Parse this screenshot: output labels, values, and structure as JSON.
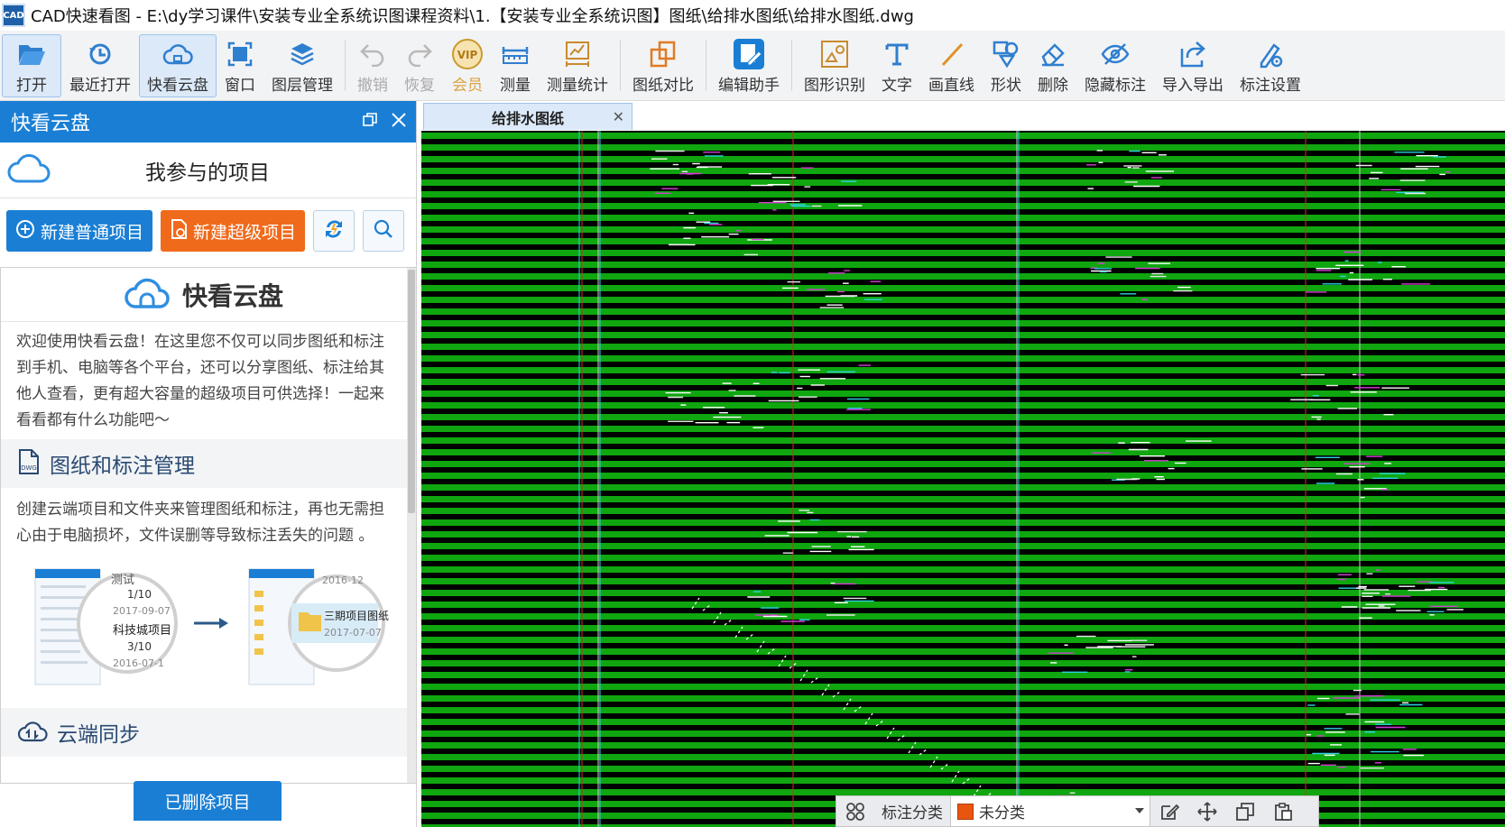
{
  "window": {
    "app_icon_text": "CAD",
    "title": "CAD快速看图 - E:\\dy学习课件\\安装专业全系统识图课程资料\\1.【安装专业全系统识图】图纸\\给排水图纸\\给排水图纸.dwg"
  },
  "toolbar": {
    "open": "打开",
    "recent": "最近打开",
    "cloud": "快看云盘",
    "window": "窗口",
    "layers": "图层管理",
    "undo": "撤销",
    "redo": "恢复",
    "vip": "会员",
    "vip_badge": "VIP",
    "measure": "测量",
    "measure_stats": "测量统计",
    "compare": "图纸对比",
    "edit_assistant": "编辑助手",
    "shape_recognize": "图形识别",
    "text": "文字",
    "line": "画直线",
    "shape": "形状",
    "delete": "删除",
    "hide_marks": "隐藏标注",
    "import_export": "导入导出",
    "mark_settings": "标注设置"
  },
  "panel": {
    "title": "快看云盘",
    "project_heading": "我参与的项目",
    "new_normal": "新建普通项目",
    "new_super": "新建超级项目",
    "brand": "快看云盘",
    "intro": "欢迎使用快看云盘！在这里您不仅可以同步图纸和标注到手机、电脑等各个平台，还可以分享图纸、标注给其他人查看，更有超大容量的超级项目可供选择！一起来看看都有什么功能吧～",
    "section1_title": "图纸和标注管理",
    "section1_desc": "创建云端项目和文件夹来管理图纸和标注，再也无需担心由于电脑损坏，文件误删等导致标注丢失的问题 。",
    "illus_left_a": "1/10",
    "illus_left_a_date": "2017-09-07",
    "illus_left_b": "科技城项目",
    "illus_left_b_count": "3/10",
    "illus_left_b_date": "2016-07-1",
    "illus_left_top": "测试",
    "illus_right_top": "2016-12",
    "illus_right_name": "三期项目图纸",
    "illus_right_date": "2017-07-07",
    "section2_title": "云端同步",
    "deleted_projects": "已删除项目"
  },
  "tab": {
    "label": "给排水图纸"
  },
  "status": {
    "category_label": "标注分类",
    "category_value": "未分类",
    "swatch_color": "#e8550f"
  }
}
